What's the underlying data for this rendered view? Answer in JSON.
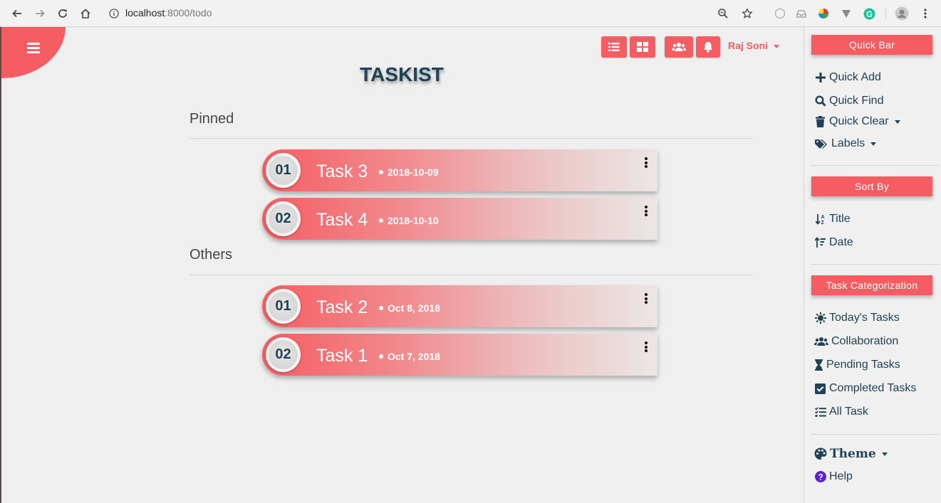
{
  "browser": {
    "url_host": "localhost",
    "url_path": ":8000/todo"
  },
  "app": {
    "title": "TASKIST",
    "user_name": "Raj Soni"
  },
  "sections": {
    "pinned": {
      "label": "Pinned",
      "tasks": [
        {
          "num": "01",
          "name": "Task 3",
          "date": "2018-10-09"
        },
        {
          "num": "02",
          "name": "Task 4",
          "date": "2018-10-10"
        }
      ]
    },
    "others": {
      "label": "Others",
      "tasks": [
        {
          "num": "01",
          "name": "Task 2",
          "date": "Oct 8, 2018"
        },
        {
          "num": "02",
          "name": "Task 1",
          "date": "Oct 7, 2018"
        }
      ]
    }
  },
  "sidebar": {
    "quick_bar": {
      "header": "Quick Bar",
      "items": [
        "Quick Add",
        "Quick Find",
        "Quick Clear",
        "Labels"
      ]
    },
    "sort_by": {
      "header": "Sort By",
      "items": [
        "Title",
        "Date"
      ]
    },
    "categorization": {
      "header": "Task Categorization",
      "items": [
        "Today's Tasks",
        "Collaboration",
        "Pending Tasks",
        "Completed Tasks",
        "All Task"
      ]
    },
    "footer": {
      "theme": "Theme",
      "help": "Help"
    }
  },
  "colors": {
    "accent": "#f65d62",
    "text_dark": "#214155",
    "background": "#efefef"
  }
}
